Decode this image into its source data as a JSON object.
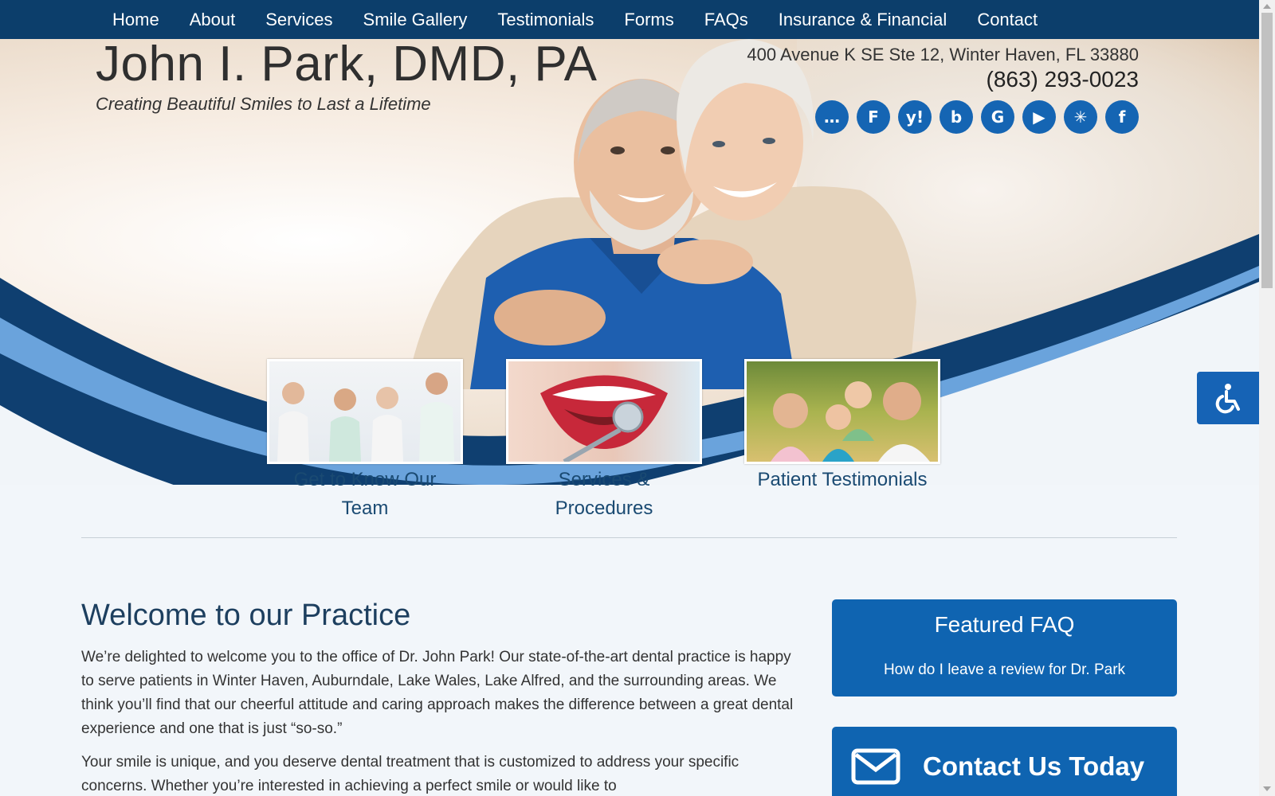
{
  "nav": {
    "items": [
      {
        "label": "Home"
      },
      {
        "label": "About"
      },
      {
        "label": "Services"
      },
      {
        "label": "Smile Gallery"
      },
      {
        "label": "Testimonials"
      },
      {
        "label": "Forms"
      },
      {
        "label": "FAQs"
      },
      {
        "label": "Insurance & Financial"
      },
      {
        "label": "Contact"
      }
    ]
  },
  "brand": {
    "name": "John I. Park, DMD, PA",
    "tagline": "Creating Beautiful Smiles to Last a Lifetime"
  },
  "contact": {
    "address": "400 Avenue K SE Ste 12, Winter Haven, FL 33880",
    "phone": "(863) 293-0023"
  },
  "socials": [
    {
      "icon": "chat-review-icon",
      "glyph": "…"
    },
    {
      "icon": "foursquare-icon",
      "glyph": "F"
    },
    {
      "icon": "yahoo-icon",
      "glyph": "y!"
    },
    {
      "icon": "bing-icon",
      "glyph": "b"
    },
    {
      "icon": "google-icon",
      "glyph": "G"
    },
    {
      "icon": "youtube-icon",
      "glyph": "▶"
    },
    {
      "icon": "yelp-icon",
      "glyph": "✳"
    },
    {
      "icon": "facebook-icon",
      "glyph": "f"
    }
  ],
  "features": [
    {
      "caption_line1": "Get to Know Our",
      "caption_line2": "Team"
    },
    {
      "caption_line1": "Services &",
      "caption_line2": "Procedures"
    },
    {
      "caption_line1": "Patient Testimonials",
      "caption_line2": ""
    }
  ],
  "welcome": {
    "title": "Welcome to our Practice",
    "p1": "We’re delighted to welcome you to the office of Dr. John Park! Our state-of-the-art dental practice is happy to serve patients in Winter Haven, Auburndale, Lake Wales, Lake Alfred, and the surrounding areas. We think you’ll find that our cheerful attitude and caring approach makes the difference between a great dental experience and one that is just “so-so.”",
    "p2": "Your smile is unique, and you deserve dental treatment that is customized to address your specific concerns. Whether you’re interested in achieving a perfect smile or would like to"
  },
  "sidebar": {
    "faq_title": "Featured FAQ",
    "faq_question": "How do I leave a review for Dr. Park",
    "cta_label": "Contact Us Today"
  },
  "colors": {
    "nav_bg": "#0c3e6b",
    "accent_blue": "#0f64b1",
    "heading": "#1d3f5f"
  }
}
